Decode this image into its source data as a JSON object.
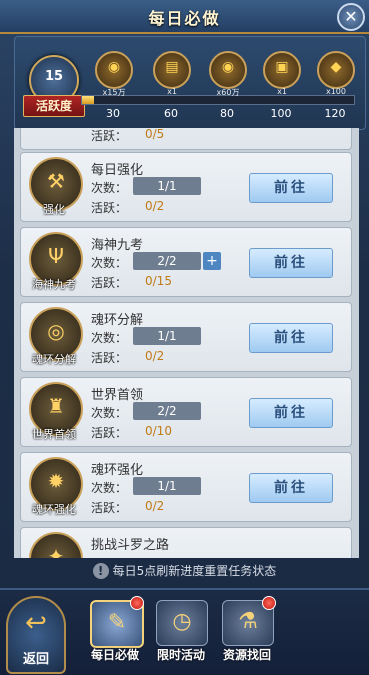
{
  "header": {
    "title": "每日必做",
    "close_icon": "✕"
  },
  "activity": {
    "value": "15",
    "label": "活跃度",
    "progress_fraction": 0.045,
    "thresholds": [
      "30",
      "60",
      "80",
      "100",
      "120"
    ],
    "rewards": [
      {
        "icon": "coin-pile-icon",
        "count": "x15万"
      },
      {
        "icon": "scroll-icon",
        "count": "x1"
      },
      {
        "icon": "coin-pile-icon",
        "count": "x60万"
      },
      {
        "icon": "chest-icon",
        "count": "x1"
      },
      {
        "icon": "gem-icon",
        "count": "x100"
      }
    ]
  },
  "tasks": [
    {
      "name": "",
      "icon": "partial-icon",
      "icon_label": "",
      "count": "",
      "activity_label": "活跃：",
      "activity": "0/5",
      "show_plus": false,
      "partial": true
    },
    {
      "name": "每日强化",
      "icon": "anvil-icon",
      "icon_label": "强化",
      "count_label": "次数：",
      "count": "1/1",
      "activity_label": "活跃：",
      "activity": "0/2",
      "show_plus": false,
      "go": "前往"
    },
    {
      "name": "海神九考",
      "icon": "trident-icon",
      "icon_label": "海神九考",
      "count_label": "次数：",
      "count": "2/2",
      "activity_label": "活跃：",
      "activity": "0/15",
      "show_plus": true,
      "go": "前往"
    },
    {
      "name": "魂环分解",
      "icon": "ring-icon",
      "icon_label": "魂环分解",
      "count_label": "次数：",
      "count": "1/1",
      "activity_label": "活跃：",
      "activity": "0/2",
      "show_plus": false,
      "go": "前往"
    },
    {
      "name": "世界首领",
      "icon": "helmet-icon",
      "icon_label": "世界首领",
      "count_label": "次数：",
      "count": "2/2",
      "activity_label": "活跃：",
      "activity": "0/10",
      "show_plus": false,
      "go": "前往"
    },
    {
      "name": "魂环强化",
      "icon": "flame-ring-icon",
      "icon_label": "魂环强化",
      "count_label": "次数：",
      "count": "1/1",
      "activity_label": "活跃：",
      "activity": "0/2",
      "show_plus": false,
      "go": "前往"
    },
    {
      "name": "挑战斗罗之路",
      "icon": "road-icon",
      "icon_label": "",
      "partial": true
    }
  ],
  "notice": {
    "icon": "!",
    "text": "每日5点刷新进度重置任务状态"
  },
  "bottom_nav": {
    "back": "返回",
    "tabs": [
      {
        "label": "每日必做",
        "icon": "daily-icon",
        "active": true,
        "badge": true
      },
      {
        "label": "限时活动",
        "icon": "clock-icon",
        "active": false,
        "badge": false
      },
      {
        "label": "资源找回",
        "icon": "retrieve-icon",
        "active": false,
        "badge": true
      }
    ]
  },
  "colors": {
    "accent_gold": "#d0a95c",
    "activity_value": "#c07a18",
    "go_button": "#9fcaf0"
  }
}
